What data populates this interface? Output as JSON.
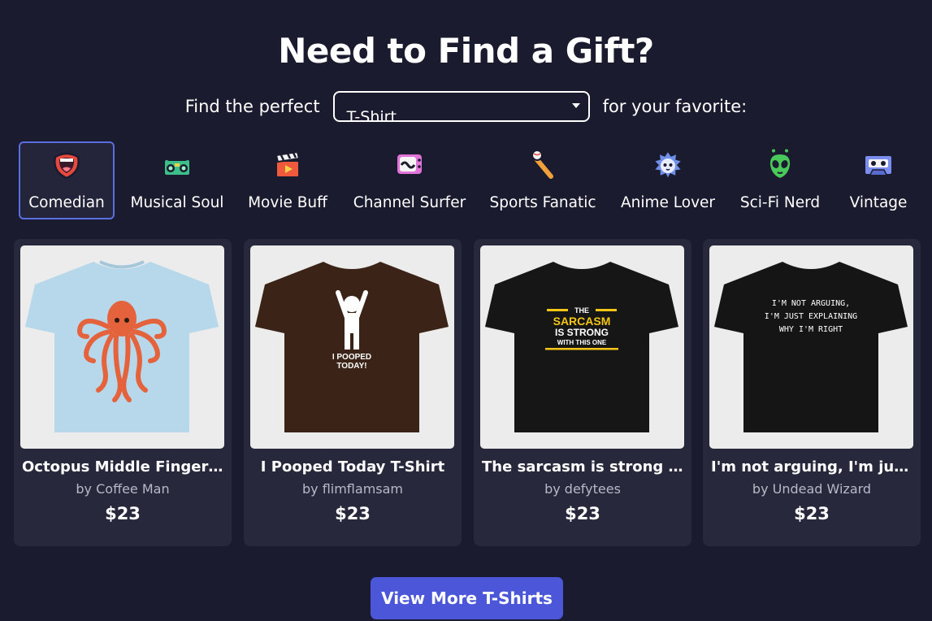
{
  "headline": "Need to Find a Gift?",
  "finder": {
    "prefix": "Find the perfect",
    "selected": "T-Shirt",
    "suffix": "for your favorite:"
  },
  "categories": [
    {
      "label": "Comedian",
      "icon": "laughing-mouth-icon",
      "active": true
    },
    {
      "label": "Musical Soul",
      "icon": "boombox-icon",
      "active": false
    },
    {
      "label": "Movie Buff",
      "icon": "clapperboard-icon",
      "active": false
    },
    {
      "label": "Channel Surfer",
      "icon": "retro-tv-icon",
      "active": false
    },
    {
      "label": "Sports Fanatic",
      "icon": "bat-and-ball-icon",
      "active": false
    },
    {
      "label": "Anime Lover",
      "icon": "anime-face-icon",
      "active": false
    },
    {
      "label": "Sci-Fi Nerd",
      "icon": "alien-icon",
      "active": false
    },
    {
      "label": "Vintage",
      "icon": "cassette-tape-icon",
      "active": false
    }
  ],
  "products": [
    {
      "title": "Octopus Middle Fingers...",
      "artist": "by Coffee Man",
      "price": "$23",
      "shirt_color": "#b7d8ea",
      "print_text": ""
    },
    {
      "title": "I Pooped Today T-Shirt",
      "artist": "by flimflamsam",
      "price": "$23",
      "shirt_color": "#3b2417",
      "print_text": "I POOPED TODAY!"
    },
    {
      "title": "The sarcasm is strong w...",
      "artist": "by defytees",
      "price": "$23",
      "shirt_color": "#161616",
      "print_text": "THE SARCASM IS STRONG WITH THIS ONE"
    },
    {
      "title": "I'm not arguing, I'm just ...",
      "artist": "by Undead Wizard",
      "price": "$23",
      "shirt_color": "#151515",
      "print_text": "I'M NOT ARGUING, I'M JUST EXPLAINING WHY I'M RIGHT"
    }
  ],
  "cta": "View More T-Shirts",
  "colors": {
    "background": "#1a1b2e",
    "card": "#27283b",
    "accent": "#4b57d8",
    "active_border": "#5b6ee1"
  }
}
